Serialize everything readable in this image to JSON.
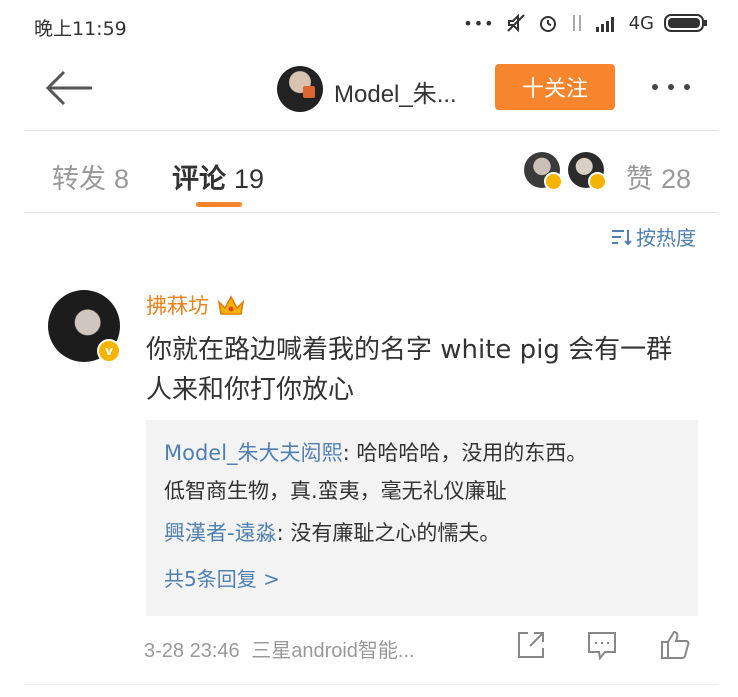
{
  "status": {
    "time": "晚上11:59",
    "network": "4G"
  },
  "nav": {
    "username": "Model_朱...",
    "follow_label": "十关注"
  },
  "tabs": [
    {
      "label": "转发",
      "count": "8"
    },
    {
      "label": "评论",
      "count": "19"
    },
    {
      "label": "赞",
      "count": "28"
    }
  ],
  "sort_label": "按热度",
  "comment": {
    "user": "拂菻坊",
    "text": "你就在路边喊着我的名字 white pig 会有一群人来和你打你放心",
    "replies": [
      {
        "user": "Model_朱大夫闳熙",
        "text": ": 哈哈哈哈，没用的东西。",
        "text2": "低智商生物，真.蛮夷，毫无礼仪廉耻"
      },
      {
        "user": "興漢者-遠淼",
        "text": ": 没有廉耻之心的懦夫。"
      }
    ],
    "more_replies": "共5条回复 >",
    "time": "3-28 23:46",
    "source": "三星android智能..."
  },
  "colors": {
    "accent": "#f7852e",
    "link": "#5080b0",
    "username": "#e8831f"
  }
}
